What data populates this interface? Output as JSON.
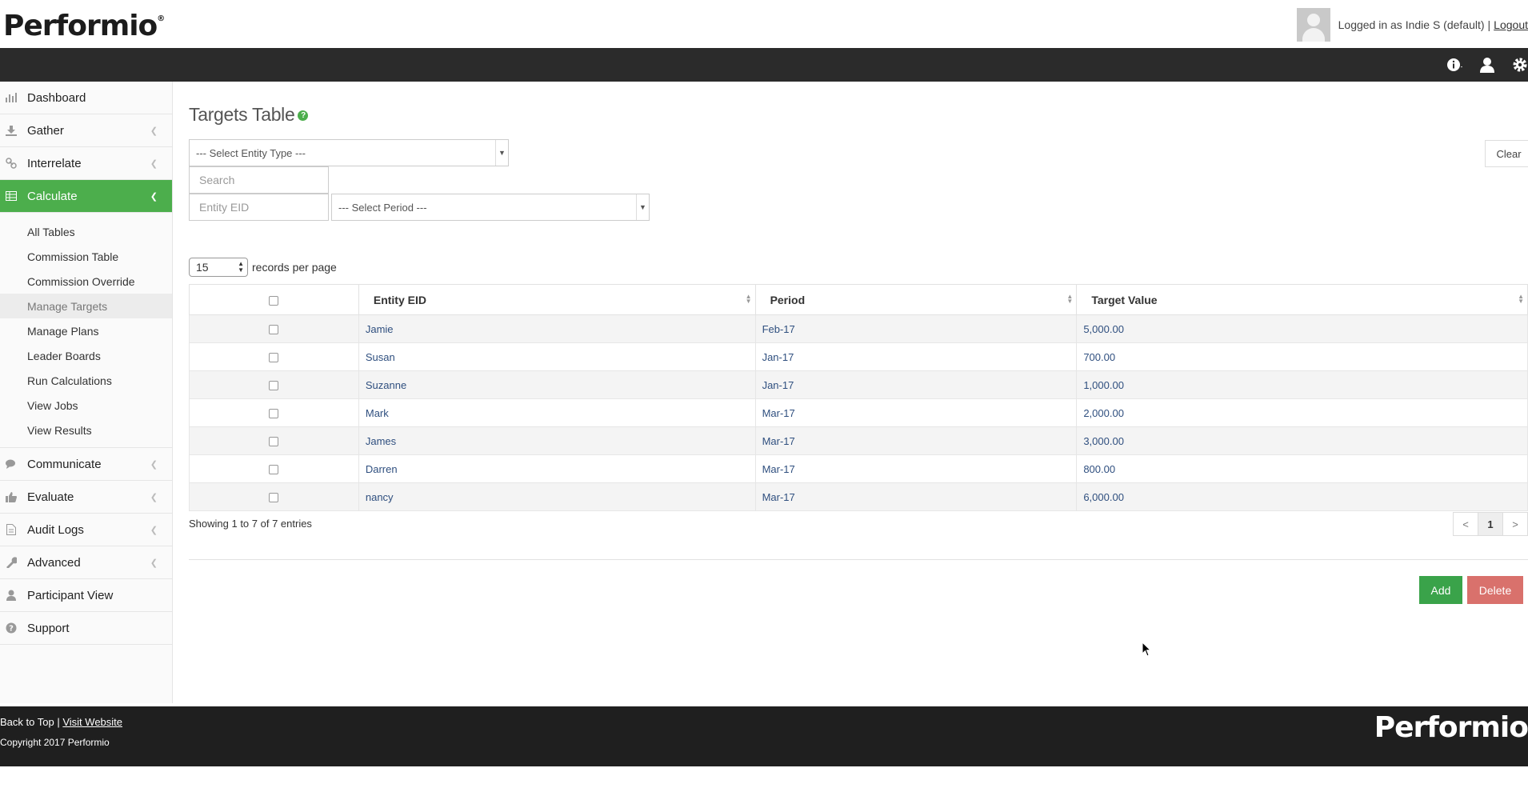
{
  "brand": {
    "logo_text": "Performio"
  },
  "header": {
    "logged_in_text": "Logged in as Indie S (default)",
    "separator": "|",
    "logout_label": "Logout"
  },
  "sidebar": {
    "items": [
      {
        "label": "Dashboard",
        "icon": "bar-chart-icon"
      },
      {
        "label": "Gather",
        "icon": "download-icon"
      },
      {
        "label": "Interrelate",
        "icon": "link-icon"
      },
      {
        "label": "Calculate",
        "icon": "table-icon"
      },
      {
        "label": "Communicate",
        "icon": "comments-icon"
      },
      {
        "label": "Evaluate",
        "icon": "thumbs-up-icon"
      },
      {
        "label": "Audit Logs",
        "icon": "file-icon"
      },
      {
        "label": "Advanced",
        "icon": "wrench-icon"
      },
      {
        "label": "Participant View",
        "icon": "user-icon"
      },
      {
        "label": "Support",
        "icon": "question-icon"
      }
    ],
    "calculate_sub": [
      "All Tables",
      "Commission Table",
      "Commission Override",
      "Manage Targets",
      "Manage Plans",
      "Leader Boards",
      "Run Calculations",
      "View Jobs",
      "View Results"
    ]
  },
  "main": {
    "title": "Targets Table",
    "entity_type_placeholder": "--- Select Entity Type ---",
    "search_placeholder": "Search",
    "entity_eid_placeholder": "Entity EID",
    "period_placeholder": "--- Select Period ---",
    "clear_label": "Clear",
    "per_page_value": "15",
    "per_page_label": "records per page",
    "columns": [
      "Entity EID",
      "Period",
      "Target Value"
    ],
    "rows": [
      {
        "entity": "Jamie",
        "period": "Feb-17",
        "value": "5,000.00"
      },
      {
        "entity": "Susan",
        "period": "Jan-17",
        "value": "700.00"
      },
      {
        "entity": "Suzanne",
        "period": "Jan-17",
        "value": "1,000.00"
      },
      {
        "entity": "Mark",
        "period": "Mar-17",
        "value": "2,000.00"
      },
      {
        "entity": "James",
        "period": "Mar-17",
        "value": "3,000.00"
      },
      {
        "entity": "Darren",
        "period": "Mar-17",
        "value": "800.00"
      },
      {
        "entity": "nancy",
        "period": "Mar-17",
        "value": "6,000.00"
      }
    ],
    "showing_text": "Showing 1 to 7 of 7 entries",
    "pager": {
      "prev": "<",
      "current": "1",
      "next": ">"
    },
    "add_label": "Add",
    "delete_label": "Delete"
  },
  "footer": {
    "back_to_top": "Back to Top",
    "separator": "|",
    "visit_website": "Visit Website",
    "copyright": "Copyright 2017 Performio",
    "logo_text": "Performio"
  },
  "colors": {
    "accent_green": "#4cae4c",
    "add_green": "#3aa34a",
    "delete_red": "#d9716c",
    "dark_bar": "#2b2b2b",
    "footer": "#1f1f1f"
  }
}
